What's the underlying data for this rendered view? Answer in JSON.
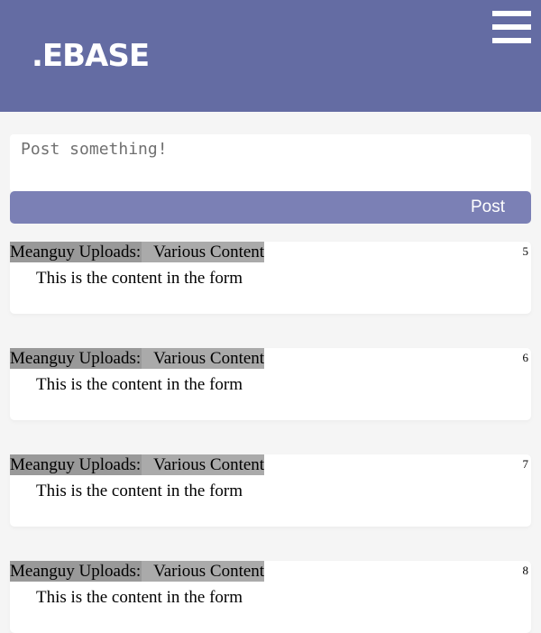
{
  "header": {
    "logo": ".EBASE",
    "menu_icon": "hamburger-menu-icon",
    "background": "#646ca3"
  },
  "composer": {
    "placeholder": "Post something!",
    "value": "",
    "post_label": "Post",
    "button_color": "#7b80b5"
  },
  "posts": [
    {
      "author": "Meanguy Uploads:",
      "category": "Various Content",
      "number": "5",
      "content": "This is the content in the form"
    },
    {
      "author": "Meanguy Uploads:",
      "category": "Various Content",
      "number": "6",
      "content": "This is the content in the form"
    },
    {
      "author": "Meanguy Uploads:",
      "category": "Various Content",
      "number": "7",
      "content": "This is the content in the form"
    },
    {
      "author": "Meanguy Uploads:",
      "category": "Various Content",
      "number": "8",
      "content": "This is the content in the form"
    }
  ]
}
